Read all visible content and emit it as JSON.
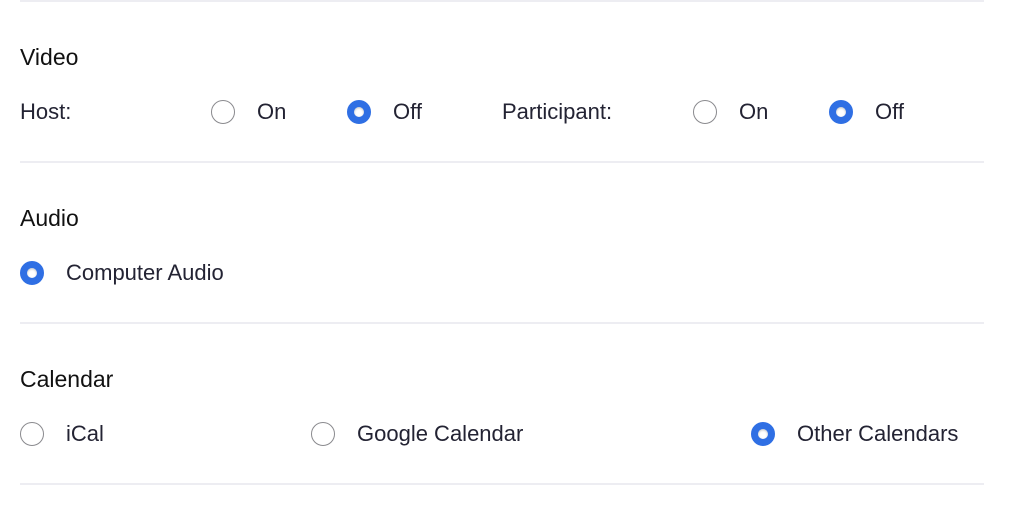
{
  "colors": {
    "accent": "#2f6fe4",
    "divider": "#ededf2",
    "text": "#232333"
  },
  "video": {
    "title": "Video",
    "host_label": "Host:",
    "participant_label": "Participant:",
    "host_options": [
      {
        "label": "On",
        "checked": false
      },
      {
        "label": "Off",
        "checked": true
      }
    ],
    "participant_options": [
      {
        "label": "On",
        "checked": false
      },
      {
        "label": "Off",
        "checked": true
      }
    ]
  },
  "audio": {
    "title": "Audio",
    "options": [
      {
        "label": "Computer Audio",
        "checked": true
      }
    ]
  },
  "calendar": {
    "title": "Calendar",
    "options": [
      {
        "label": "iCal",
        "checked": false
      },
      {
        "label": "Google Calendar",
        "checked": false
      },
      {
        "label": "Other Calendars",
        "checked": true
      }
    ]
  }
}
